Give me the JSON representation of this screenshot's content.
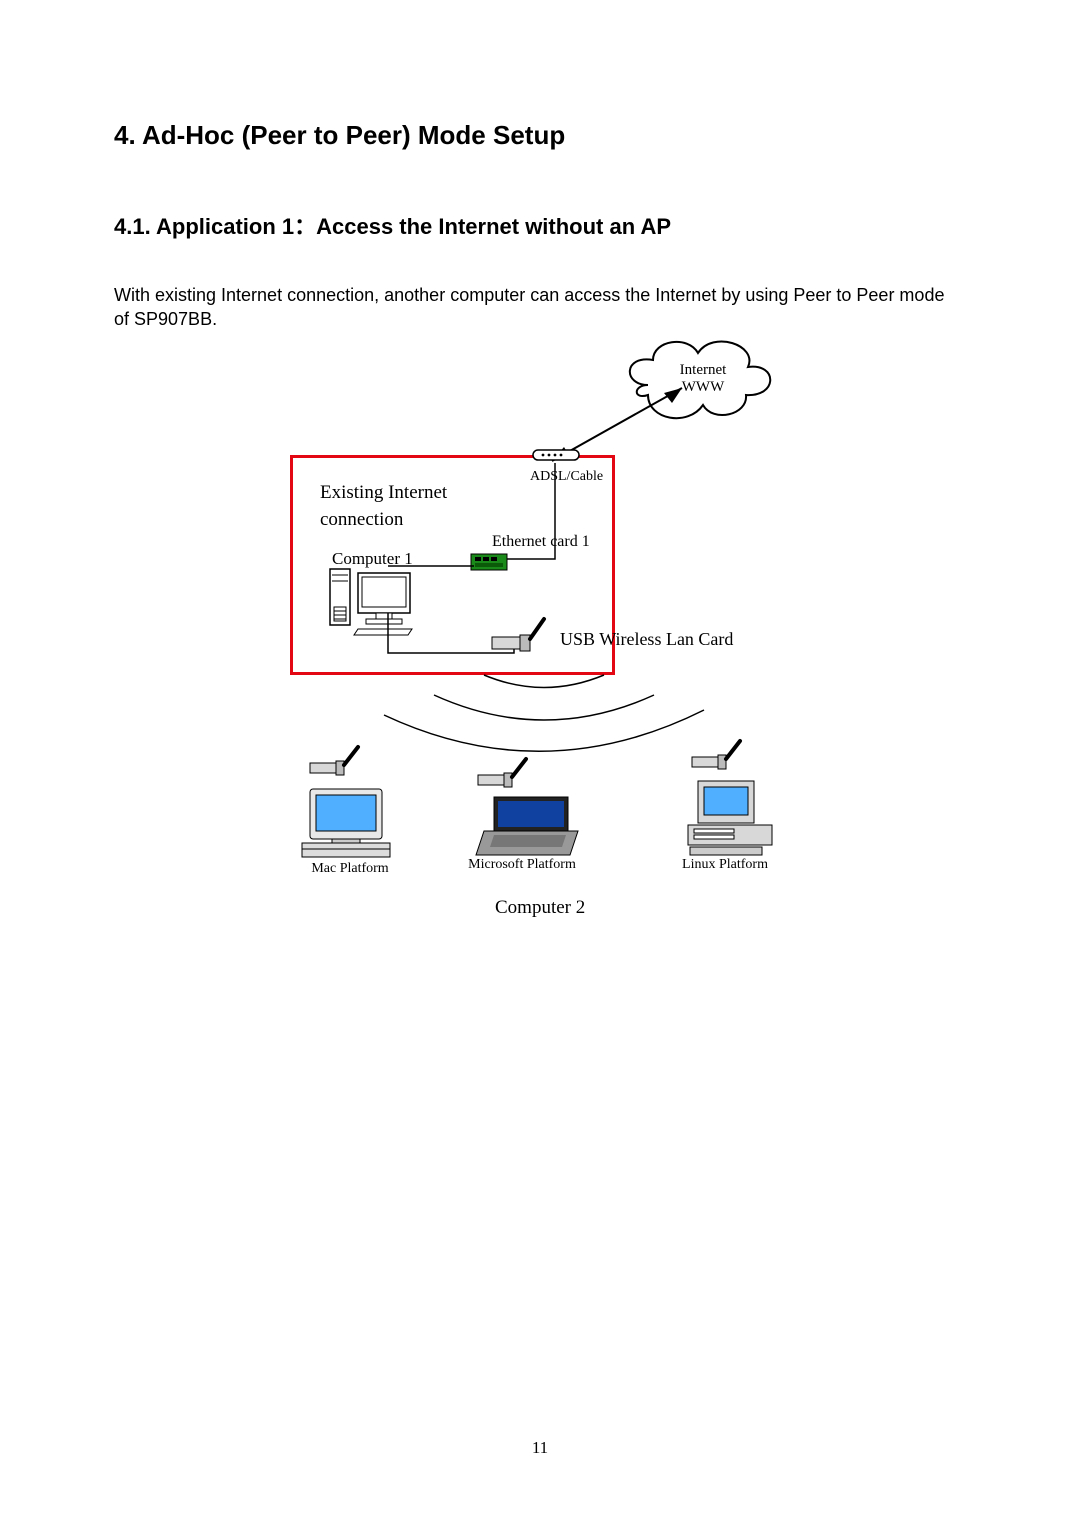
{
  "section_title": "4. Ad-Hoc (Peer to Peer) Mode Setup",
  "subsection_title": "4.1. Application 1：Access the Internet without an AP",
  "body": "With existing Internet connection, another computer can access the Internet by using Peer to Peer mode of SP907BB.",
  "diagram": {
    "cloud": "Internet\nWWW",
    "existing": "Existing Internet connection",
    "computer1": "Computer 1",
    "modem": "ADSL/Cable",
    "ethcard": "Ethernet card 1",
    "usb_card": "USB Wireless Lan Card",
    "mac": "Mac Platform",
    "ms": "Microsoft Platform",
    "linux": "Linux  Platform",
    "computer2": "Computer 2"
  },
  "page_number": "11"
}
